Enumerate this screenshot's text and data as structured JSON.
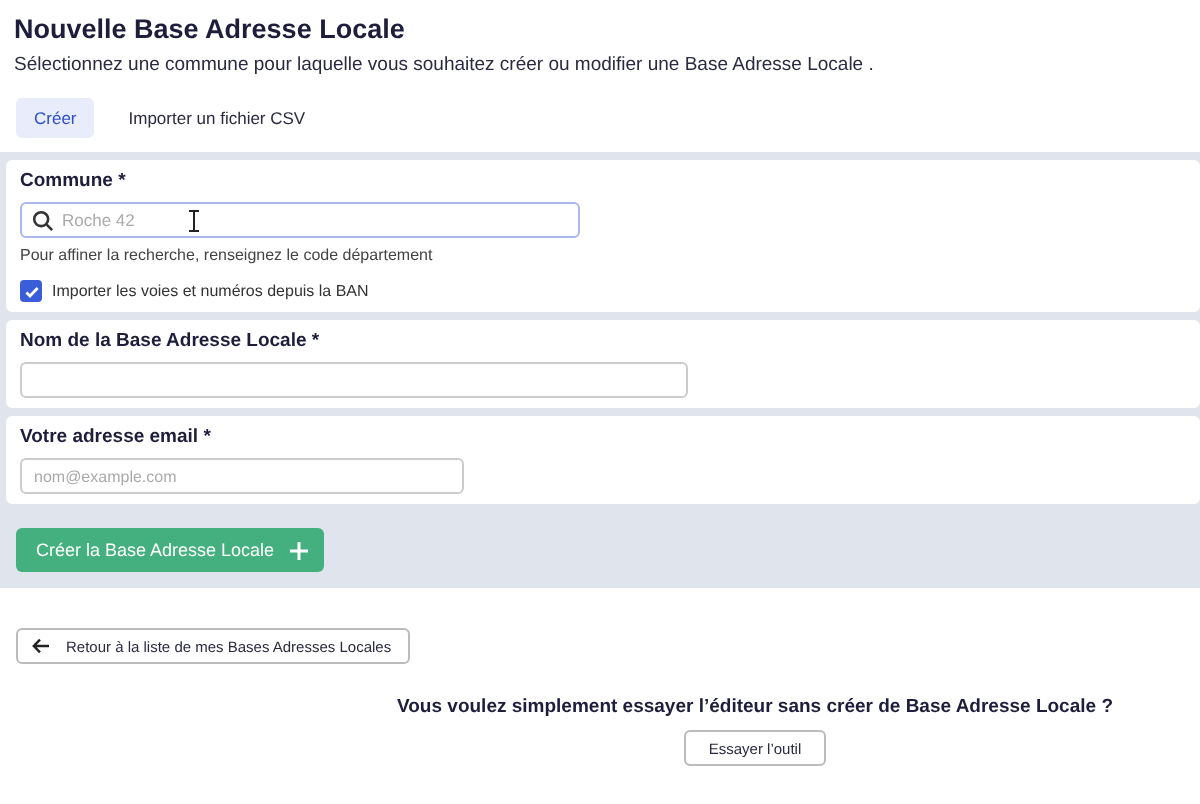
{
  "title": "Nouvelle Base Adresse Locale",
  "subtitle": "Sélectionnez une commune pour laquelle vous souhaitez créer ou modifier une Base Adresse Locale .",
  "tabs": [
    {
      "label": "Créer",
      "selected": true
    },
    {
      "label": "Importer un fichier CSV",
      "selected": false
    }
  ],
  "commune": {
    "label": "Commune *",
    "placeholder": "Roche 42",
    "hint": "Pour affiner la recherche, renseignez le code département"
  },
  "import_ban": {
    "label": "Importer les voies et numéros depuis la BAN",
    "checked": true
  },
  "name_field": {
    "label": "Nom de la Base Adresse Locale *"
  },
  "email_field": {
    "label": "Votre adresse email *",
    "placeholder": "nom@example.com"
  },
  "submit_button": "Créer la Base Adresse Locale",
  "back_button": "Retour à la liste de mes Bases Adresses Locales",
  "try_question": "Vous voulez simplement essayer l’éditeur sans créer de Base Adresse Locale ?",
  "try_button": "Essayer l’outil"
}
